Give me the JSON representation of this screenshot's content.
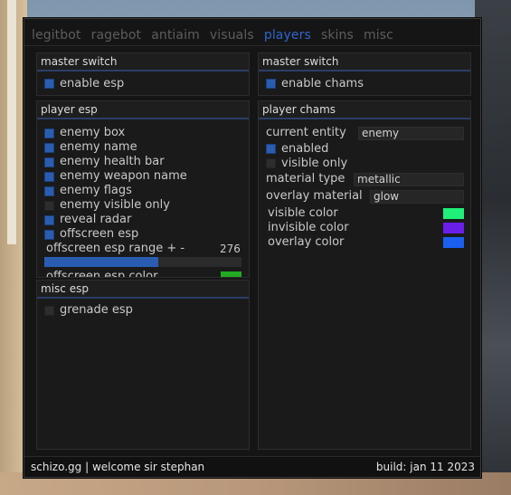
{
  "tabs": [
    "legitbot",
    "ragebot",
    "antiaim",
    "visuals",
    "players",
    "skins",
    "misc"
  ],
  "active_tab": "players",
  "left_master": {
    "title": "master switch",
    "item": {
      "label": "enable esp",
      "checked": true
    }
  },
  "right_master": {
    "title": "master switch",
    "item": {
      "label": "enable chams",
      "checked": true
    }
  },
  "player_esp": {
    "title": "player esp",
    "items": [
      {
        "label": "enemy box",
        "checked": true
      },
      {
        "label": "enemy name",
        "checked": true
      },
      {
        "label": "enemy health bar",
        "checked": true
      },
      {
        "label": "enemy weapon name",
        "checked": true
      },
      {
        "label": "enemy flags",
        "checked": true
      },
      {
        "label": "enemy visible only",
        "checked": false
      },
      {
        "label": "reveal radar",
        "checked": true
      },
      {
        "label": "offscreen esp",
        "checked": true
      }
    ],
    "slider": {
      "label": "offscreen esp range + -",
      "value": "276",
      "fill_fraction": 0.58
    },
    "cut_label": "offscreen esp color",
    "cut_color": "#22aa22"
  },
  "misc_esp": {
    "title": "misc esp",
    "items": [
      {
        "label": "grenade esp",
        "checked": false
      }
    ]
  },
  "player_chams": {
    "title": "player chams",
    "current_entity": {
      "label": "current entity",
      "value": "enemy"
    },
    "enabled": {
      "label": "enabled",
      "checked": true
    },
    "visible_only": {
      "label": "visible only",
      "checked": false
    },
    "material_type": {
      "label": "material type",
      "value": "metallic"
    },
    "overlay_material": {
      "label": "overlay material",
      "value": "glow"
    },
    "colors": [
      {
        "label": "visible color",
        "color": "#1ef07a"
      },
      {
        "label": "invisible color",
        "color": "#6a1ee8"
      },
      {
        "label": "overlay color",
        "color": "#1a5ff0"
      }
    ]
  },
  "footer": {
    "left": "schizo.gg | welcome sir stephan",
    "right": "build: jan 11 2023"
  },
  "accent": "#2f66c9"
}
